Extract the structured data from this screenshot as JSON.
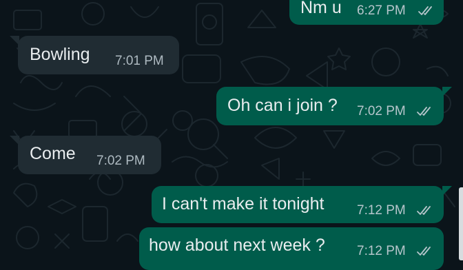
{
  "colors": {
    "background": "#0b141a",
    "outgoing_bubble": "#005c4b",
    "incoming_bubble": "#202c33",
    "text": "#e9edef",
    "timestamp": "#b7c6cc",
    "ticks": "#b7c6cc"
  },
  "messages": [
    {
      "direction": "outgoing",
      "text": "Nm u",
      "time": "6:27 PM",
      "status_icon": "double-check-icon"
    },
    {
      "direction": "incoming",
      "text": "Bowling",
      "time": "7:01 PM"
    },
    {
      "direction": "outgoing",
      "text": "Oh can i join ?",
      "time": "7:02 PM",
      "status_icon": "double-check-icon"
    },
    {
      "direction": "incoming",
      "text": "Come",
      "time": "7:02 PM"
    },
    {
      "direction": "outgoing",
      "text": "I can't make it tonight",
      "time": "7:12 PM",
      "status_icon": "double-check-icon"
    },
    {
      "direction": "outgoing",
      "text": "how about next week ?",
      "time": "7:12 PM",
      "status_icon": "double-check-icon"
    }
  ]
}
